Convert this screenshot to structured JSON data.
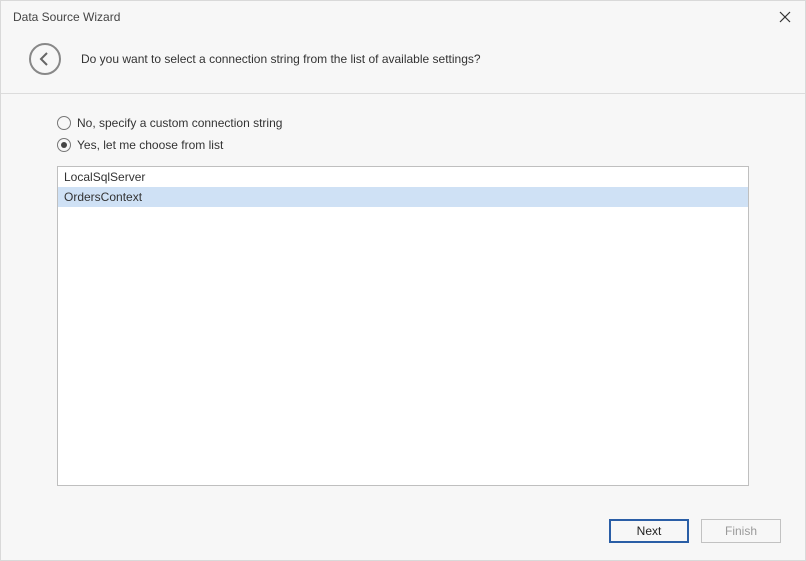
{
  "window": {
    "title": "Data Source Wizard"
  },
  "header": {
    "question": "Do you want to select a connection string from the list of available settings?"
  },
  "options": {
    "custom": {
      "label": "No, specify a custom connection string",
      "selected": false
    },
    "fromList": {
      "label": "Yes, let me choose from list",
      "selected": true
    }
  },
  "list": {
    "items": [
      {
        "label": "LocalSqlServer",
        "selected": false
      },
      {
        "label": "OrdersContext",
        "selected": true
      }
    ]
  },
  "footer": {
    "next": "Next",
    "finish": "Finish"
  }
}
